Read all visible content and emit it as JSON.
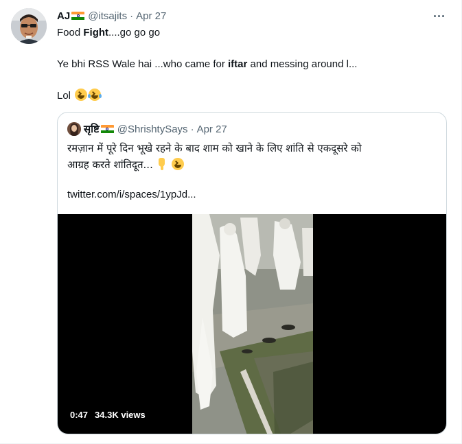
{
  "tweet": {
    "author_name": "AJ",
    "handle": "@itsajits",
    "separator": "·",
    "date": "Apr 27",
    "line1_prefix": "Food ",
    "line1_bold": "Fight",
    "line1_suffix": "....go go go",
    "line2_prefix": "Ye bhi RSS Wale hai ...who came for ",
    "line2_bold": "iftar",
    "line2_suffix": " and messing around l...",
    "line3": "Lol",
    "icons": [
      "india-flag-icon",
      "more-options-icon",
      "grinning-squinting-face-icon",
      "face-with-tears-of-joy-icon"
    ]
  },
  "quoted": {
    "author_name": "सृष्टि",
    "handle": "@ShrishtySays",
    "separator": "·",
    "date": "Apr 27",
    "line1": "रमज़ान में पूरे दिन भूखे रहने के बाद शाम को खाने के लिए शांति से एकदूसरे को",
    "line2": "आग्रह करते शांतिदूत...",
    "link": "twitter.com/i/spaces/1ypJd...",
    "icons": [
      "backhand-index-pointing-down-icon",
      "grinning-squinting-face-icon"
    ]
  },
  "video": {
    "duration": "0:47",
    "views": "34.3K views"
  },
  "colors": {
    "text": "#0f1419",
    "muted": "#536471",
    "border": "#cfd9de"
  }
}
